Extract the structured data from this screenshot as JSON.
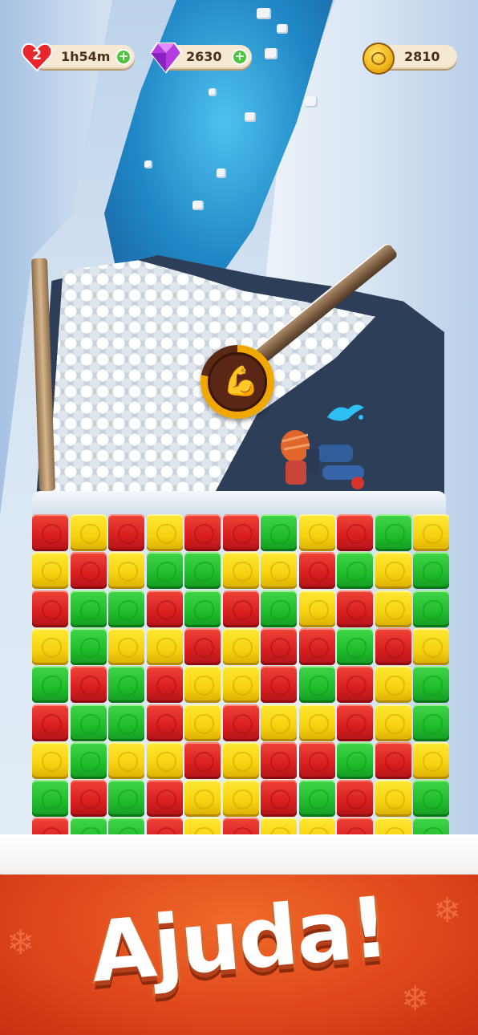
{
  "hud": {
    "lives": {
      "count": "2",
      "timer": "1h54m",
      "icon": "heart-icon",
      "add_icon": "plus-icon"
    },
    "gems": {
      "count": "2630",
      "icon": "gem-icon",
      "add_icon": "plus-icon"
    },
    "coins": {
      "count": "2810",
      "icon": "coin-icon"
    }
  },
  "booster": {
    "icon": "flexed-biceps-icon",
    "glyph": "💪",
    "progress": 0.78
  },
  "board": {
    "columns": 11,
    "rows": 9,
    "colors": {
      "red": "#e02a24",
      "yellow": "#f6d60f",
      "green": "#27c233"
    },
    "grid": [
      [
        "R",
        "Y",
        "R",
        "Y",
        "R",
        "R",
        "G",
        "Y",
        "R",
        "G",
        "Y"
      ],
      [
        "Y",
        "R",
        "Y",
        "G",
        "G",
        "Y",
        "Y",
        "R",
        "G",
        "Y",
        "G"
      ],
      [
        "R",
        "G",
        "G",
        "R",
        "G",
        "R",
        "G",
        "Y",
        "R",
        "Y",
        "G"
      ],
      [
        "Y",
        "G",
        "Y",
        "Y",
        "R",
        "Y",
        "R",
        "R",
        "G",
        "R",
        "Y"
      ],
      [
        "G",
        "R",
        "G",
        "R",
        "Y",
        "Y",
        "R",
        "G",
        "R",
        "Y",
        "G"
      ],
      [
        "R",
        "G",
        "G",
        "R",
        "Y",
        "R",
        "Y",
        "Y",
        "R",
        "Y",
        "G"
      ],
      [
        "Y",
        "G",
        "Y",
        "Y",
        "R",
        "Y",
        "R",
        "R",
        "G",
        "R",
        "Y"
      ],
      [
        "G",
        "R",
        "G",
        "R",
        "Y",
        "Y",
        "R",
        "G",
        "R",
        "Y",
        "G"
      ],
      [
        "R",
        "G",
        "G",
        "R",
        "Y",
        "R",
        "Y",
        "Y",
        "R",
        "Y",
        "G"
      ]
    ]
  },
  "banner": {
    "title": "Ajuda!"
  }
}
